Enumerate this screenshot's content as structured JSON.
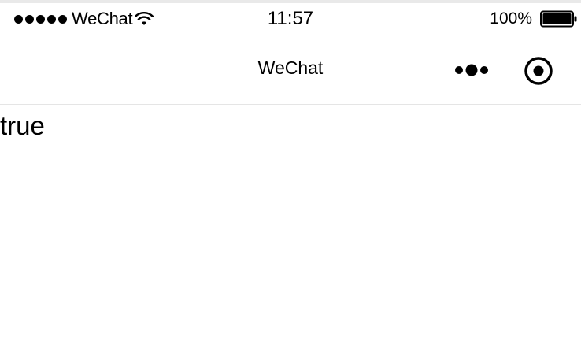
{
  "status_bar": {
    "signal_icon": "signal-dots-icon",
    "carrier": "WeChat",
    "wifi_icon": "wifi-icon",
    "time": "11:57",
    "battery_percent": "100%",
    "battery_icon": "battery-icon",
    "battery_level": 1.0
  },
  "nav_bar": {
    "title": "WeChat",
    "more_icon": "more-dots-icon",
    "close_icon": "close-target-icon"
  },
  "main": {
    "value_text": "true"
  }
}
